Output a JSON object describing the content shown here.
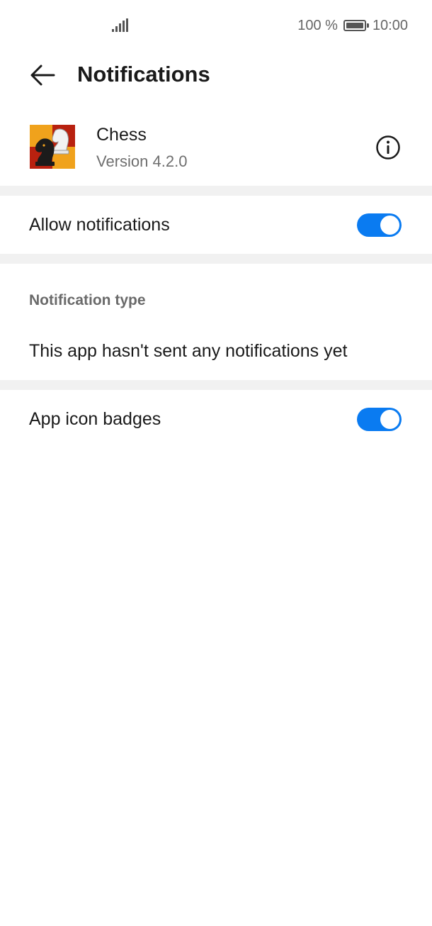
{
  "status_bar": {
    "battery_percent": "100 %",
    "time": "10:00",
    "icons": [
      "signal-icon",
      "battery-icon"
    ]
  },
  "header": {
    "title": "Notifications",
    "back_icon": "back-arrow-icon"
  },
  "app": {
    "name": "Chess",
    "version": "Version 4.2.0",
    "info_icon": "info-icon"
  },
  "settings": {
    "allow_notifications": {
      "label": "Allow notifications",
      "enabled": true
    },
    "notification_type": {
      "header": "Notification type",
      "empty_message": "This app hasn't sent any notifications yet"
    },
    "app_icon_badges": {
      "label": "App icon badges",
      "enabled": true
    }
  },
  "colors": {
    "accent": "#0a7bf1",
    "divider": "#f1f1f1",
    "secondary_text": "#6f6f6f"
  }
}
